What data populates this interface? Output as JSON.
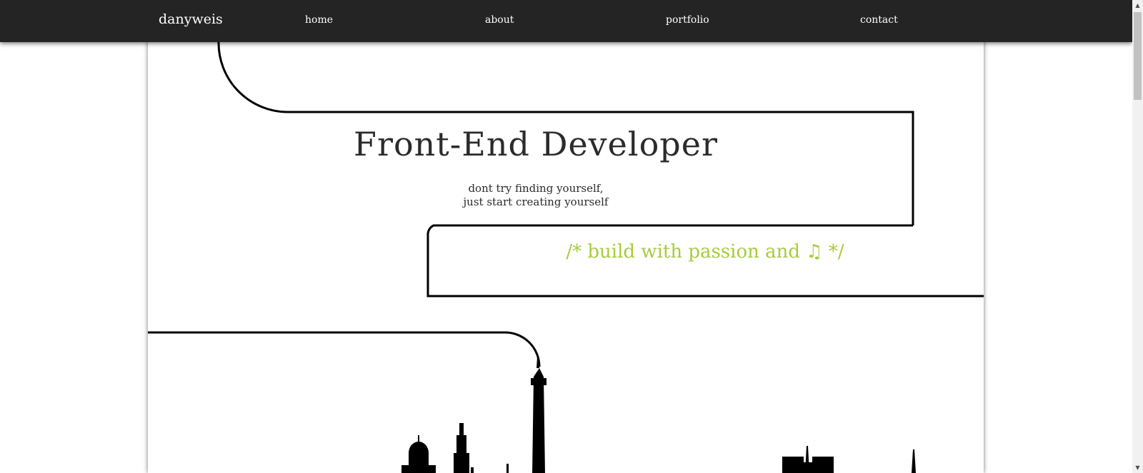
{
  "nav": {
    "brand": "danyweis",
    "links": [
      "home",
      "about",
      "portfolio",
      "contact"
    ]
  },
  "hero": {
    "title": "Front-End Developer",
    "quote_line1": "dont try finding yourself,",
    "quote_line2": "just start creating yourself",
    "tagline": "/* build with passion and ♫ */"
  },
  "colors": {
    "navbar": "#242424",
    "text": "#2b2b2b",
    "accent": "#a6cc3a",
    "lines": "#000000"
  },
  "icons": {
    "music_note": "music-note-icon",
    "skyline": "city-skyline-illustration"
  }
}
